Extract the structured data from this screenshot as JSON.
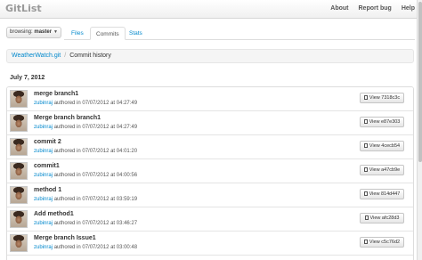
{
  "app": {
    "title": "GitList"
  },
  "nav": {
    "about": "About",
    "report_bug": "Report bug",
    "help": "Help"
  },
  "branch": {
    "prefix": "browsing:",
    "name": "master"
  },
  "tabs": [
    {
      "label": "Files",
      "active": false
    },
    {
      "label": "Commits",
      "active": true
    },
    {
      "label": "Stats",
      "active": false
    }
  ],
  "breadcrumb": {
    "repo": "WeatherWatch.git",
    "separator": "/",
    "current": "Commit history"
  },
  "date_header": "July 7, 2012",
  "commits": [
    {
      "message": "merge branch1",
      "author": "zubinraj",
      "authored_text": "authored in 07/07/2012 at 04:27:49",
      "button": "View 7318c3c"
    },
    {
      "message": "Merge branch branch1",
      "author": "zubinraj",
      "authored_text": "authored in 07/07/2012 at 04:27:49",
      "button": "View e87e303"
    },
    {
      "message": "commit 2",
      "author": "zubinraj",
      "authored_text": "authored in 07/07/2012 at 04:01:20",
      "button": "View 4cecb54"
    },
    {
      "message": "commit1",
      "author": "zubinraj",
      "authored_text": "authored in 07/07/2012 at 04:00:56",
      "button": "View a47cb9e"
    },
    {
      "message": "method 1",
      "author": "zubinraj",
      "authored_text": "authored in 07/07/2012 at 03:59:19",
      "button": "View 814d447"
    },
    {
      "message": "Add method1",
      "author": "zubinraj",
      "authored_text": "authored in 07/07/2012 at 03:46:27",
      "button": "View afc28d3"
    },
    {
      "message": "Merge branch Issue1",
      "author": "zubinraj",
      "authored_text": "authored in 07/07/2012 at 03:00:48",
      "button": "View c5c76d2"
    }
  ]
}
